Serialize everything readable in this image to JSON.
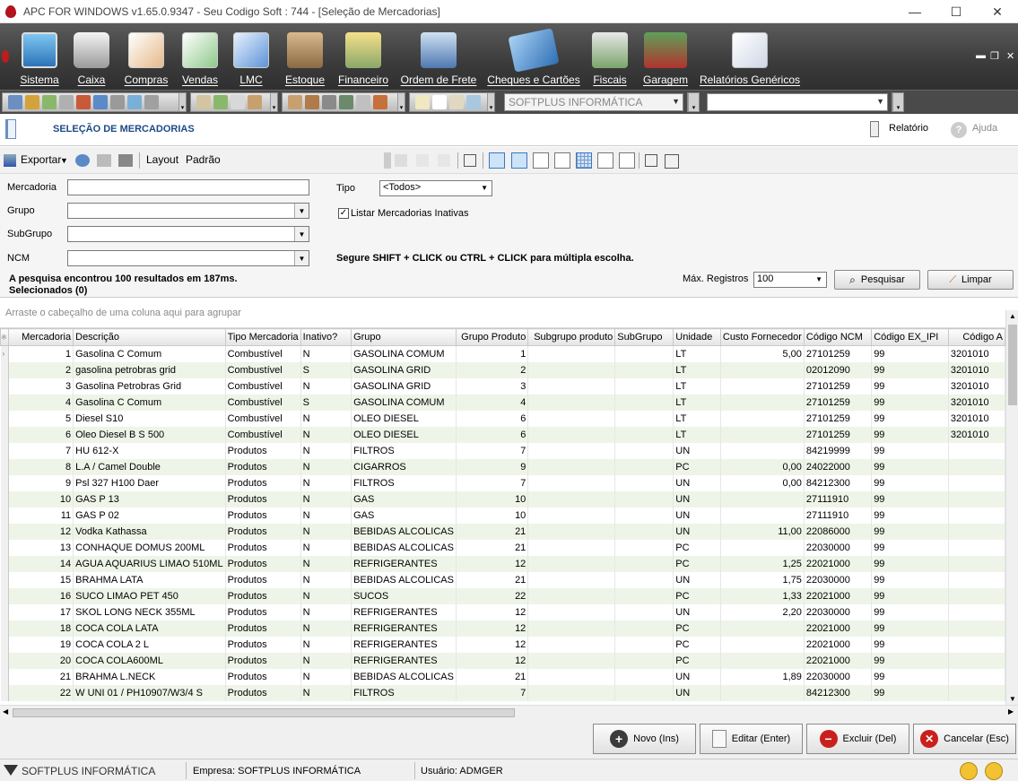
{
  "window": {
    "title": "APC FOR WINDOWS v1.65.0.9347 - Seu Codigo Soft : 744  - [Seleção de Mercadorias]",
    "minimize": "—",
    "maximize": "☐",
    "close": "✕"
  },
  "menu": [
    {
      "label": "Sistema",
      "icon": "monitor-icon"
    },
    {
      "label": "Caixa",
      "icon": "cash-register-icon"
    },
    {
      "label": "Compras",
      "icon": "document-icon"
    },
    {
      "label": "Vendas",
      "icon": "calculator-icon"
    },
    {
      "label": "LMC",
      "icon": "book-icon"
    },
    {
      "label": "Estoque",
      "icon": "boxes-icon"
    },
    {
      "label": "Financeiro",
      "icon": "money-icon"
    },
    {
      "label": "Ordem de Frete",
      "icon": "truck-icon"
    },
    {
      "label": "Cheques e Cartões",
      "icon": "credit-card-icon"
    },
    {
      "label": "Fiscais",
      "icon": "fiscal-icon"
    },
    {
      "label": "Garagem",
      "icon": "car-icon"
    },
    {
      "label": "Relatórios Genéricos",
      "icon": "report-icon"
    }
  ],
  "mdi_controls": [
    "▬",
    "❐",
    "✕"
  ],
  "toolbar": {
    "company_combo": "SOFTPLUS INFORMÁTICA",
    "second_combo": ""
  },
  "header": {
    "title": "SELEÇÃO DE MERCADORIAS",
    "report": "Relatório",
    "help": "Ajuda"
  },
  "toolbar2": {
    "export": "Exportar",
    "layout": "Layout",
    "standard": "Padrão"
  },
  "filters": {
    "mercadoria_label": "Mercadoria",
    "grupo_label": "Grupo",
    "subgrupo_label": "SubGrupo",
    "ncm_label": "NCM",
    "tipo_label": "Tipo",
    "tipo_value": "<Todos>",
    "inactive_label": "Listar Mercadorias Inativas",
    "inactive_checked": true,
    "hint": "Segure SHIFT + CLICK ou CTRL + CLICK para múltipla escolha.",
    "result": "A pesquisa encontrou 100 resultados em 187ms.",
    "selected": "Selecionados (0)",
    "max_label": "Máx. Registros",
    "max_value": "100",
    "search_button": "Pesquisar",
    "clear_button": "Limpar"
  },
  "group_hint": "Arraste o cabeçalho de uma coluna aqui para agrupar",
  "grid": {
    "columns": [
      "Mercadoria",
      "Descrição",
      "Tipo Mercadoria",
      "Inativo?",
      "Grupo",
      "Grupo Produto",
      "Subgrupo produto",
      "SubGrupo",
      "Unidade",
      "Custo Fornecedor",
      "Código NCM",
      "Código EX_IPI",
      "Código A"
    ],
    "rows": [
      [
        "1",
        "Gasolina C Comum",
        "Combustível",
        "N",
        "GASOLINA COMUM",
        "1",
        "",
        "",
        "LT",
        "5,00",
        "27101259",
        "99",
        "3201010"
      ],
      [
        "2",
        "gasolina petrobras grid",
        "Combustível",
        "S",
        "GASOLINA GRID",
        "2",
        "",
        "",
        "LT",
        "",
        "02012090",
        "99",
        "3201010"
      ],
      [
        "3",
        "Gasolina Petrobras Grid",
        "Combustível",
        "N",
        "GASOLINA GRID",
        "3",
        "",
        "",
        "LT",
        "",
        "27101259",
        "99",
        "3201010"
      ],
      [
        "4",
        "Gasolina C Comum",
        "Combustível",
        "S",
        "GASOLINA COMUM",
        "4",
        "",
        "",
        "LT",
        "",
        "27101259",
        "99",
        "3201010"
      ],
      [
        "5",
        "Diesel S10",
        "Combustível",
        "N",
        "OLEO DIESEL",
        "6",
        "",
        "",
        "LT",
        "",
        "27101259",
        "99",
        "3201010"
      ],
      [
        "6",
        "Oleo Diesel B S 500",
        "Combustível",
        "N",
        "OLEO DIESEL",
        "6",
        "",
        "",
        "LT",
        "",
        "27101259",
        "99",
        "3201010"
      ],
      [
        "7",
        "HU 612-X",
        "Produtos",
        "N",
        "FILTROS",
        "7",
        "",
        "",
        "UN",
        "",
        "84219999",
        "99",
        ""
      ],
      [
        "8",
        "L.A / Camel Double",
        "Produtos",
        "N",
        "CIGARROS",
        "9",
        "",
        "",
        "PC",
        "0,00",
        "24022000",
        "99",
        ""
      ],
      [
        "9",
        "Psl 327 H100 Daer",
        "Produtos",
        "N",
        "FILTROS",
        "7",
        "",
        "",
        "UN",
        "0,00",
        "84212300",
        "99",
        ""
      ],
      [
        "10",
        "GAS P 13",
        "Produtos",
        "N",
        "GAS",
        "10",
        "",
        "",
        "UN",
        "",
        "27111910",
        "99",
        ""
      ],
      [
        "11",
        "GAS P 02",
        "Produtos",
        "N",
        "GAS",
        "10",
        "",
        "",
        "UN",
        "",
        "27111910",
        "99",
        ""
      ],
      [
        "12",
        "Vodka Kathassa",
        "Produtos",
        "N",
        "BEBIDAS ALCOLICAS",
        "21",
        "",
        "",
        "UN",
        "11,00",
        "22086000",
        "99",
        ""
      ],
      [
        "13",
        "CONHAQUE DOMUS 200ML",
        "Produtos",
        "N",
        "BEBIDAS ALCOLICAS",
        "21",
        "",
        "",
        "PC",
        "",
        "22030000",
        "99",
        ""
      ],
      [
        "14",
        "AGUA AQUARIUS LIMAO 510ML",
        "Produtos",
        "N",
        "REFRIGERANTES",
        "12",
        "",
        "",
        "PC",
        "1,25",
        "22021000",
        "99",
        ""
      ],
      [
        "15",
        "BRAHMA LATA",
        "Produtos",
        "N",
        "BEBIDAS ALCOLICAS",
        "21",
        "",
        "",
        "UN",
        "1,75",
        "22030000",
        "99",
        ""
      ],
      [
        "16",
        "SUCO  LIMAO PET 450",
        "Produtos",
        "N",
        "SUCOS",
        "22",
        "",
        "",
        "PC",
        "1,33",
        "22021000",
        "99",
        ""
      ],
      [
        "17",
        "SKOL LONG NECK 355ML",
        "Produtos",
        "N",
        "REFRIGERANTES",
        "12",
        "",
        "",
        "UN",
        "2,20",
        "22030000",
        "99",
        ""
      ],
      [
        "18",
        "COCA COLA LATA",
        "Produtos",
        "N",
        "REFRIGERANTES",
        "12",
        "",
        "",
        "PC",
        "",
        "22021000",
        "99",
        ""
      ],
      [
        "19",
        "COCA COLA 2 L",
        "Produtos",
        "N",
        "REFRIGERANTES",
        "12",
        "",
        "",
        "PC",
        "",
        "22021000",
        "99",
        ""
      ],
      [
        "20",
        "COCA COLA600ML",
        "Produtos",
        "N",
        "REFRIGERANTES",
        "12",
        "",
        "",
        "PC",
        "",
        "22021000",
        "99",
        ""
      ],
      [
        "21",
        "BRAHMA  L.NECK",
        "Produtos",
        "N",
        "BEBIDAS ALCOLICAS",
        "21",
        "",
        "",
        "UN",
        "1,89",
        "22030000",
        "99",
        ""
      ],
      [
        "22",
        "W UNI 01 / PH10907/W3/4 S",
        "Produtos",
        "N",
        "FILTROS",
        "7",
        "",
        "",
        "UN",
        "",
        "84212300",
        "99",
        ""
      ]
    ]
  },
  "buttons": {
    "new": "Novo (Ins)",
    "edit": "Editar (Enter)",
    "delete": "Excluir (Del)",
    "cancel": "Cancelar (Esc)"
  },
  "status": {
    "brand": "SOFTPLUS INFORMÁTICA",
    "company": "Empresa: SOFTPLUS INFORMÁTICA",
    "user": "Usuário: ADMGER"
  },
  "colors": {
    "accent": "#1d4a86",
    "menubar": "#3b3b3b",
    "row_alt": "#eef5e8"
  }
}
